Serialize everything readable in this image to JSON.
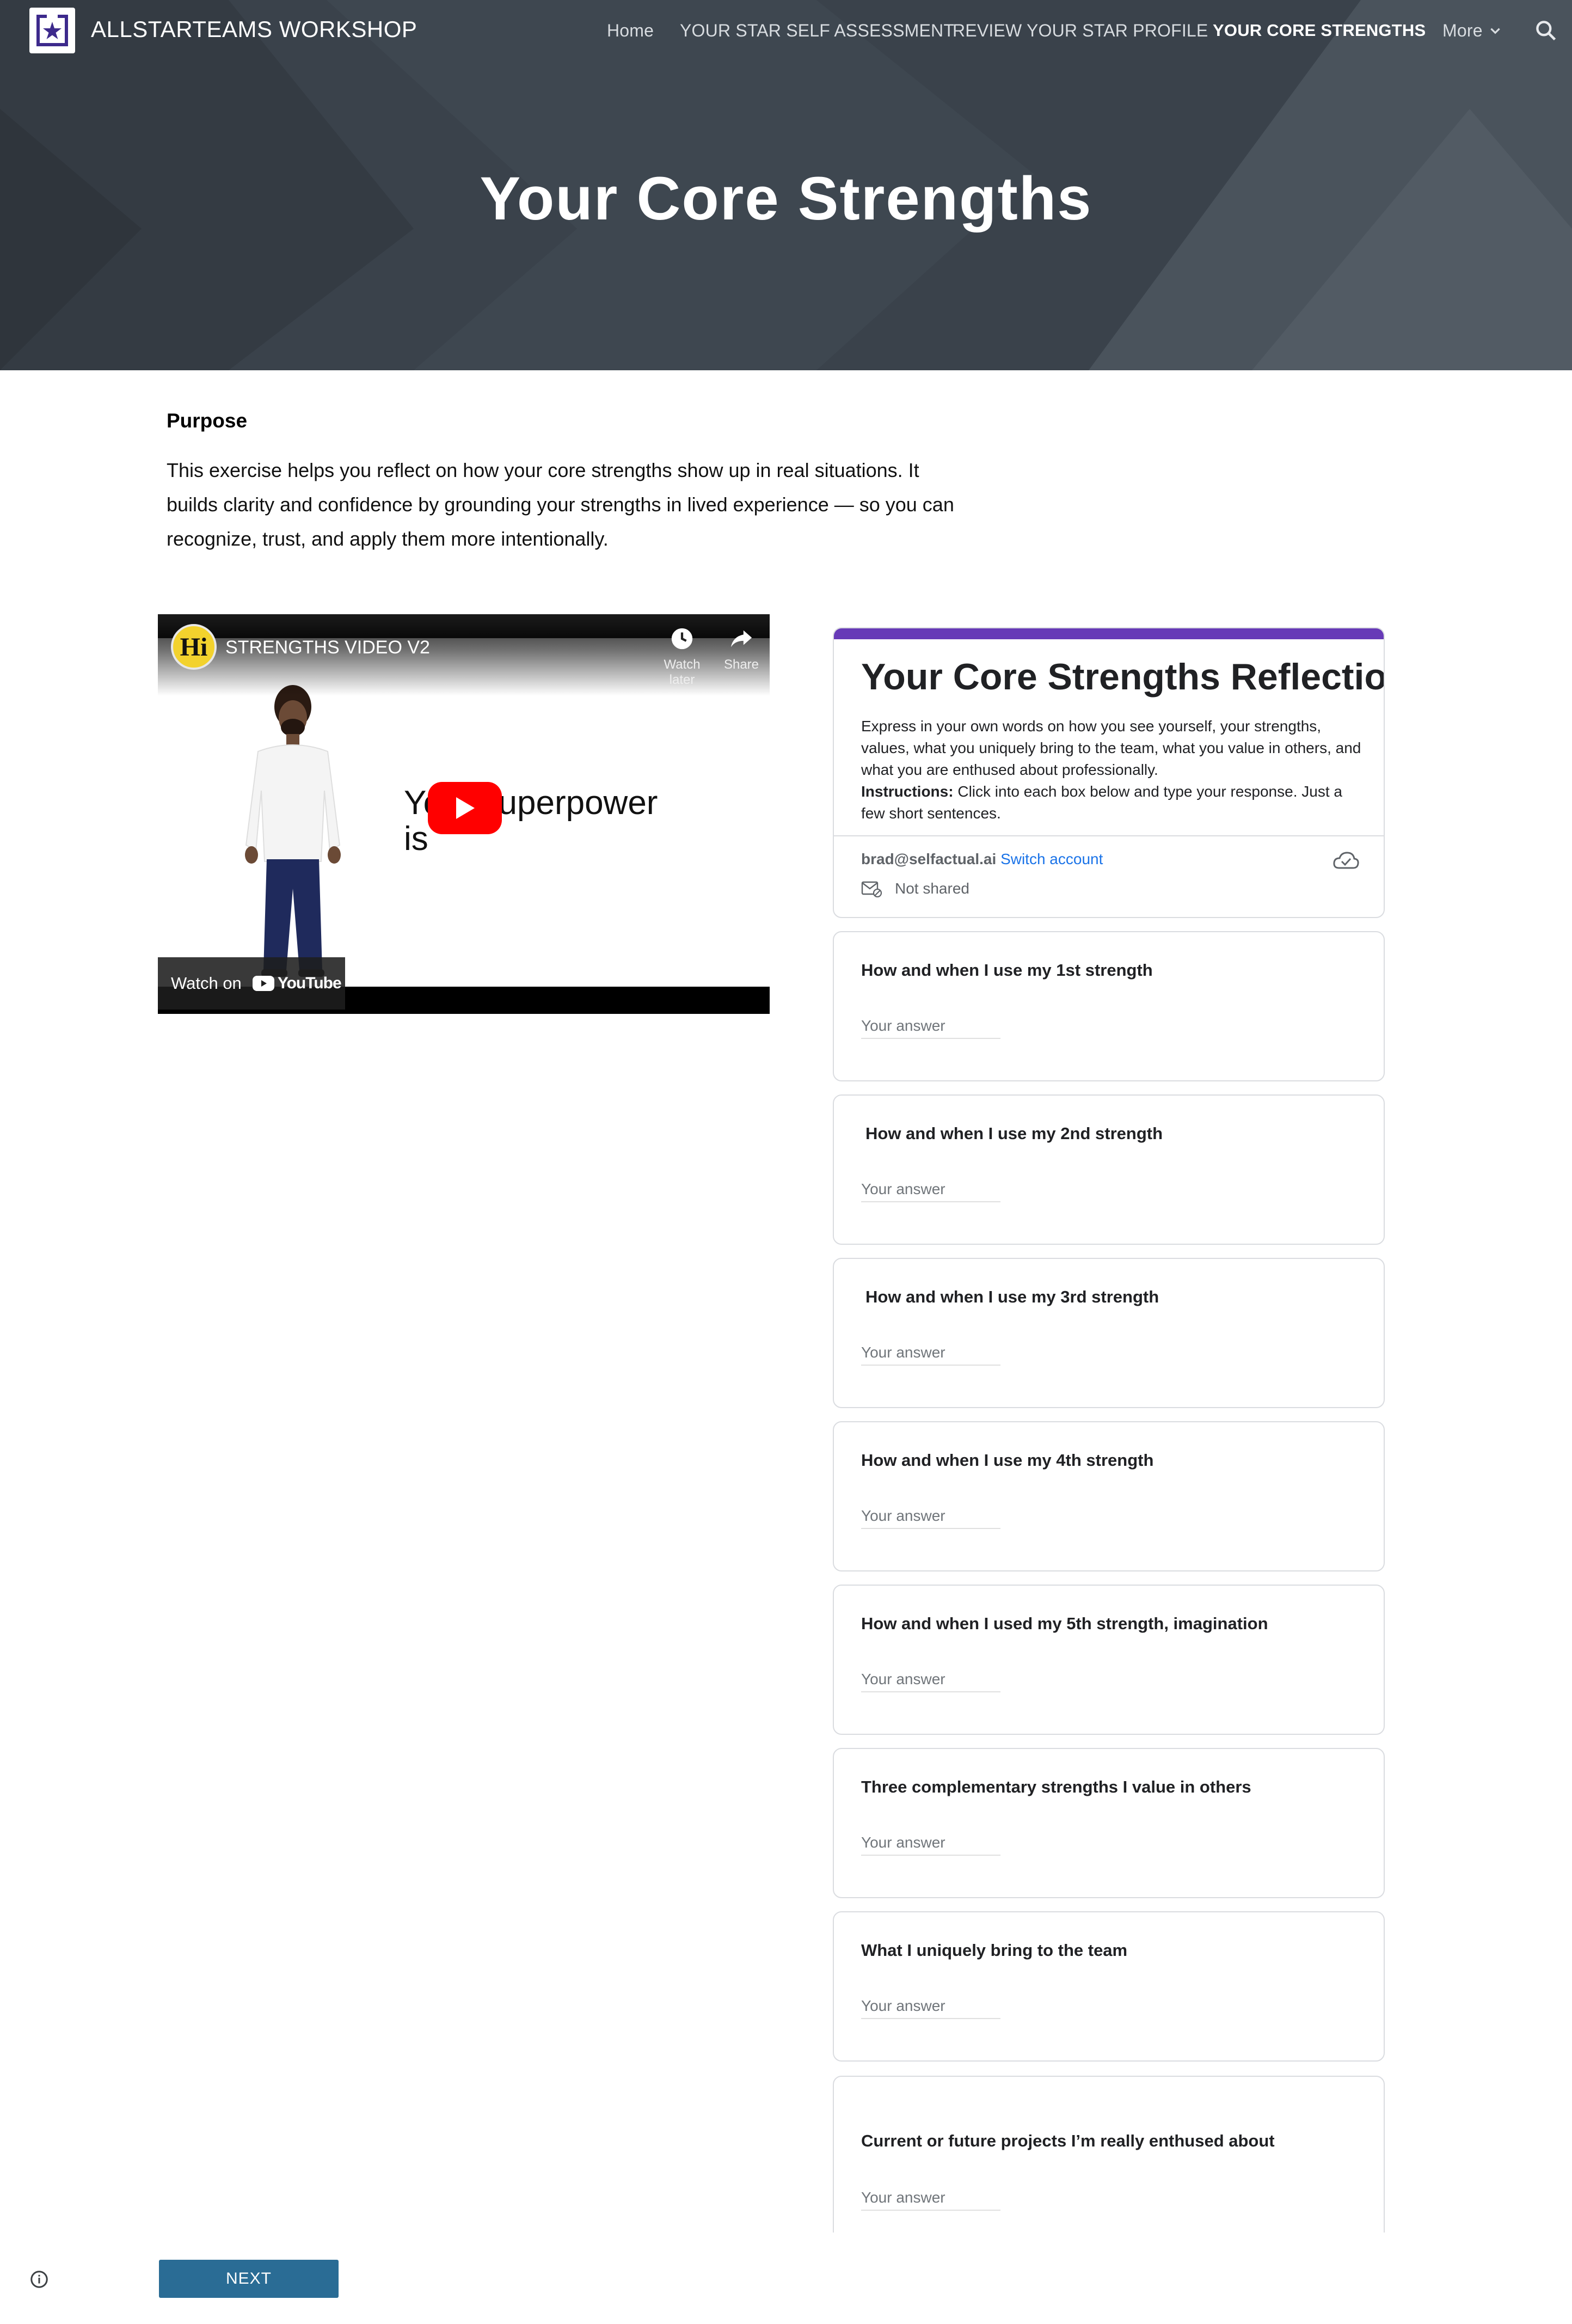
{
  "site": {
    "title": "ALLSTARTEAMS WORKSHOP",
    "nav": {
      "home": "Home",
      "assessment": "YOUR STAR SELF ASSESSMENT",
      "profile": "REVIEW YOUR STAR PROFILE",
      "strengths": "YOUR CORE STRENGTHS",
      "more": "More"
    },
    "active_nav": "YOUR CORE STRENGTHS"
  },
  "hero": {
    "title": "Your Core Strengths"
  },
  "purpose": {
    "heading": "Purpose",
    "text": "This exercise helps you reflect on how your core strengths show up in real situations. It builds clarity and confidence by grounding your strengths in lived experience — so you can recognize, trust, and apply them more intentionally."
  },
  "video": {
    "channel_initials": "Hi",
    "title": "STRENGTHS VIDEO V2",
    "watch_later": "Watch later",
    "share": "Share",
    "slide_text_line1": "Your superpower",
    "slide_text_line2": "is",
    "watch_on": "Watch on",
    "youtube": "YouTube"
  },
  "form": {
    "title": "Your Core Strengths Reflection",
    "description": "Express in your own words on how you see yourself, your strengths, values, what you uniquely bring to the team, what you value in others, and what you are enthused about professionally.",
    "instructions_label": "Instructions:",
    "instructions_text": " Click into each box below and type your response. Just a few short sentences.",
    "account_email": "brad@selfactual.ai",
    "switch_account": "Switch account",
    "not_shared": "Not shared",
    "answer_placeholder": "Your answer",
    "questions": [
      {
        "label": "How and when I use my 1st strength"
      },
      {
        "label": "How and when I use my 2nd strength"
      },
      {
        "label": "How and when I use my 3rd strength"
      },
      {
        "label": "How and when I use my 4th strength"
      },
      {
        "label": "How and when I used my 5th strength, imagination"
      },
      {
        "label": "Three complementary strengths I value in others"
      },
      {
        "label": "What I uniquely bring to the team"
      },
      {
        "label": "Current or future projects I’m really enthused about"
      }
    ]
  },
  "footer": {
    "next_label": "NEXT"
  },
  "colors": {
    "hero_bg": "#3b434c",
    "form_accent": "#673ab7",
    "link": "#1a73e8",
    "next_button": "#2a6c95",
    "youtube_red": "#ff0000"
  },
  "icons": {
    "logo": "star-logo-icon",
    "search": "search-icon",
    "more": "chevron-down-icon",
    "watch_later": "clock-icon",
    "share": "share-icon",
    "play": "play-icon",
    "cloud": "cloud-check-icon",
    "not_shared": "mail-lock-icon",
    "info": "info-icon"
  }
}
